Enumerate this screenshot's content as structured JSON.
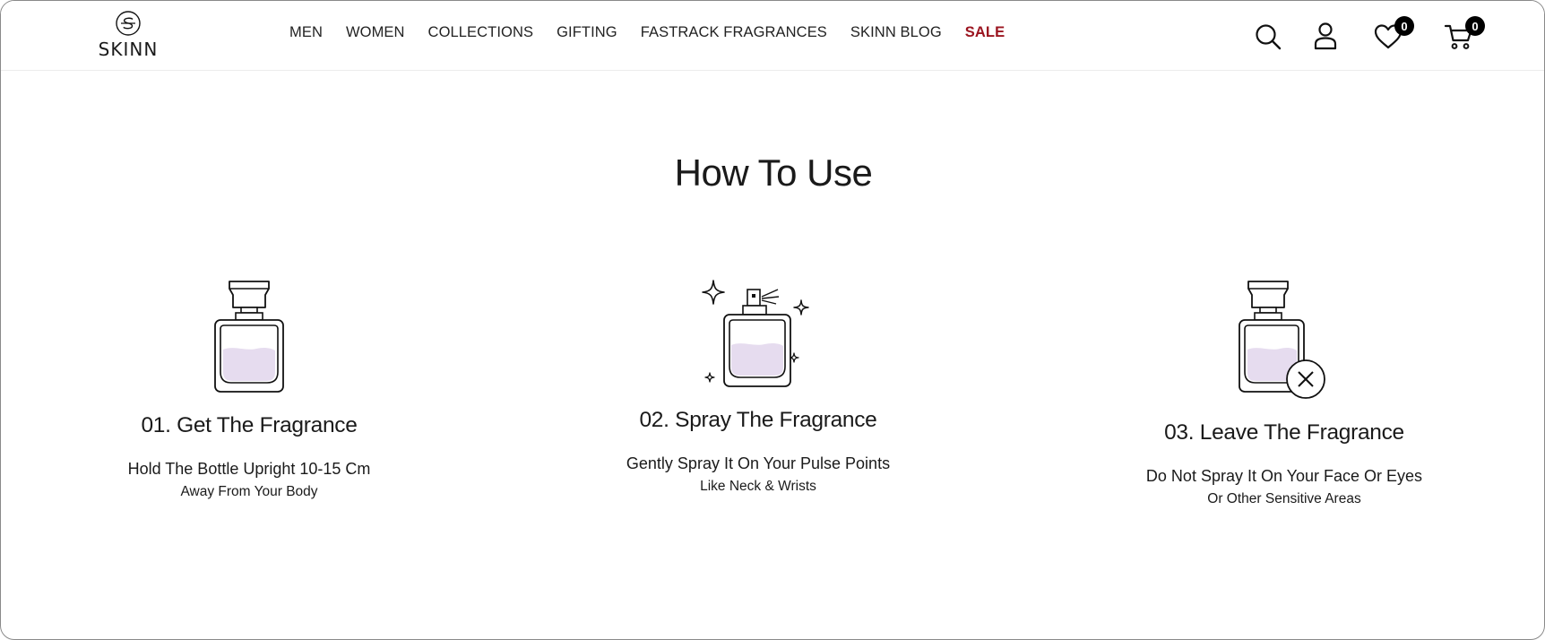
{
  "brand": {
    "name": "SKINN"
  },
  "nav": {
    "items": [
      {
        "label": "MEN"
      },
      {
        "label": "WOMEN"
      },
      {
        "label": "COLLECTIONS"
      },
      {
        "label": "GIFTING"
      },
      {
        "label": "FASTRACK FRAGRANCES"
      },
      {
        "label": "SKINN BLOG"
      },
      {
        "label": "SALE"
      }
    ],
    "sale_color": "#9b1520"
  },
  "header_icons": {
    "search": "search-icon",
    "account": "user-icon",
    "wishlist": "heart-icon",
    "cart": "cart-icon",
    "wishlist_count": "0",
    "cart_count": "0"
  },
  "section": {
    "title": "How To Use",
    "steps": [
      {
        "icon": "perfume-bottle-icon",
        "heading": "01. Get The Fragrance",
        "line1": "Hold The Bottle Upright 10-15 Cm",
        "line2": "Away From Your Body"
      },
      {
        "icon": "perfume-spray-icon",
        "heading": "02. Spray The Fragrance",
        "line1": "Gently Spray It On Your Pulse Points",
        "line2": "Like Neck & Wrists"
      },
      {
        "icon": "perfume-no-face-icon",
        "heading": "03. Leave The Fragrance",
        "line1": "Do Not Spray It On Your Face Or Eyes",
        "line2": "Or Other Sensitive Areas"
      }
    ]
  },
  "colors": {
    "liquid": "#e6dcef",
    "text": "#1a1a1a"
  }
}
